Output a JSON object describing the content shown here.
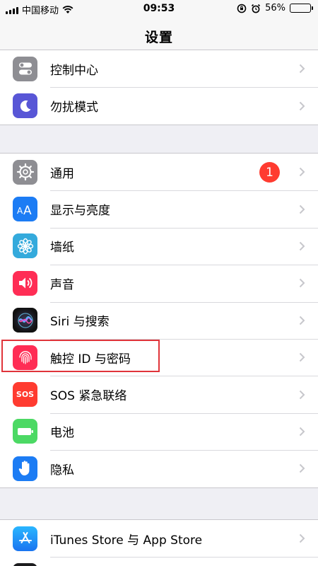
{
  "status_bar": {
    "carrier": "中国移动",
    "time": "09:53",
    "battery_percent": "56%",
    "battery_level": 0.56
  },
  "nav": {
    "title": "设置"
  },
  "sections": [
    {
      "rows": [
        {
          "label": "控制中心",
          "icon": "control-center-icon",
          "color": "#8e8e93"
        },
        {
          "label": "勿扰模式",
          "icon": "moon-icon",
          "color": "#5856d6"
        }
      ]
    },
    {
      "rows": [
        {
          "label": "通用",
          "icon": "gear-icon",
          "color": "#8e8e93",
          "badge": "1"
        },
        {
          "label": "显示与亮度",
          "icon": "text-size-icon",
          "color": "#1c7cf4"
        },
        {
          "label": "墙纸",
          "icon": "flower-icon",
          "color": "#34aadc"
        },
        {
          "label": "声音",
          "icon": "speaker-icon",
          "color": "#ff2d55"
        },
        {
          "label": "Siri 与搜索",
          "icon": "siri-icon",
          "color": "#1a1a2e"
        },
        {
          "label": "触控 ID 与密码",
          "icon": "fingerprint-icon",
          "color": "#ff2d55"
        },
        {
          "label": "SOS 紧急联络",
          "icon": "sos-icon",
          "color": "#ff3b30",
          "icon_text": "SOS"
        },
        {
          "label": "电池",
          "icon": "battery-icon",
          "color": "#4cd964"
        },
        {
          "label": "隐私",
          "icon": "hand-icon",
          "color": "#1c7cf4"
        }
      ]
    },
    {
      "rows": [
        {
          "label": "iTunes Store 与 App Store",
          "icon": "app-store-icon",
          "color": "#1c8ef9"
        }
      ]
    }
  ]
}
